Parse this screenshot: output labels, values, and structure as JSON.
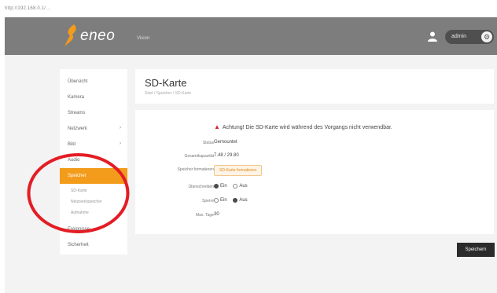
{
  "browser": {
    "address": "http://192.168.0.1/…"
  },
  "brand": {
    "logo": "eneo",
    "sub": "Vision"
  },
  "user": {
    "name": "admin"
  },
  "sidebar": {
    "items": [
      {
        "label": "Übersicht",
        "chev": ""
      },
      {
        "label": "Kamera",
        "chev": ""
      },
      {
        "label": "Streams",
        "chev": ""
      },
      {
        "label": "Netzwerk",
        "chev": "›"
      },
      {
        "label": "Bild",
        "chev": "›"
      },
      {
        "label": "Audio",
        "chev": ""
      },
      {
        "label": "Speicher",
        "chev": "›"
      }
    ],
    "subitems": [
      {
        "label": "SD-Karte"
      },
      {
        "label": "Netzwerkspeicher"
      },
      {
        "label": "Aufnahme"
      }
    ],
    "bottom_items": [
      {
        "label": "Ereignisse"
      },
      {
        "label": "Sicherheit"
      }
    ]
  },
  "header": {
    "title": "SD-Karte",
    "breadcrumb": "Start / Speicher / SD-Karte"
  },
  "form": {
    "warning": "Achtung! Die SD-Karte wird während des Vorgangs nicht verwendbar.",
    "rows": {
      "status": {
        "label": "Status",
        "value": "Gemountet"
      },
      "capacity": {
        "label": "Gesamtkapazität",
        "value": "7.48 / 29.80"
      },
      "format": {
        "label": "Speicher formatieren",
        "button": "SD-Karte formatieren"
      },
      "overwrite": {
        "label": "Überschreiben",
        "on": "Ein",
        "off": "Aus"
      },
      "lock": {
        "label": "Sperre",
        "on": "Ein",
        "off": "Aus"
      },
      "max_days": {
        "label": "Max. Tage",
        "value": "30"
      }
    }
  },
  "actions": {
    "save": "Speichern"
  },
  "colors": {
    "accent": "#f39b1b",
    "header_bg": "#7d7d7d",
    "annotation": "#e31d24",
    "warning": "#d0232a"
  }
}
